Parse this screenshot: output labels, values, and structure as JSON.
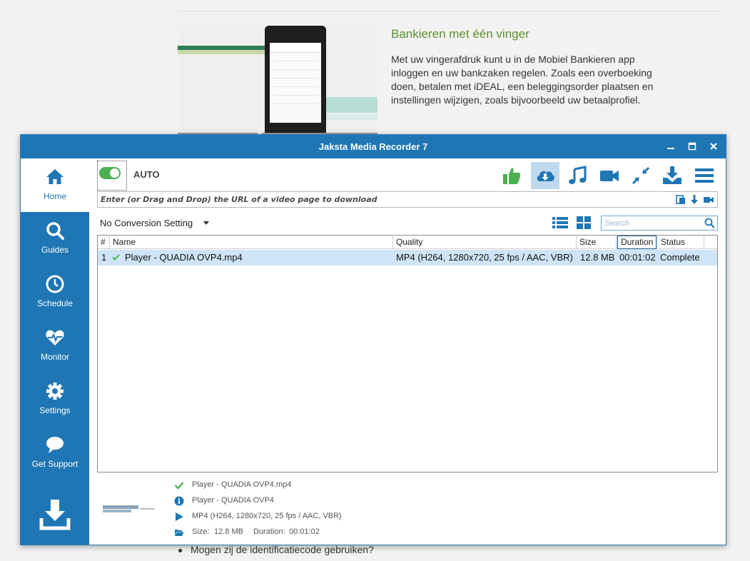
{
  "background_page": {
    "heading": "Bankieren met één vinger",
    "paragraph": "Met uw vingerafdruk kunt u in de Mobiel Bankieren app inloggen en uw bankzaken regelen. Zoals een overboeking doen, betalen met iDEAL, een beleggingsorder plaatsen en instellingen wijzigen, zoals bijvoorbeeld uw betaalprofiel.",
    "bullet": "Mogen zij de identificatiecode gebruiken?"
  },
  "window": {
    "title": "Jaksta Media Recorder 7",
    "controls": [
      "minimize-icon",
      "maximize-icon",
      "close-icon"
    ]
  },
  "sidebar": {
    "items": [
      {
        "label": "Home",
        "icon": "home-icon",
        "active": true
      },
      {
        "label": "Guides",
        "icon": "search-icon"
      },
      {
        "label": "Schedule",
        "icon": "clock-icon"
      },
      {
        "label": "Monitor",
        "icon": "heartbeat-icon"
      },
      {
        "label": "Settings",
        "icon": "gear-icon"
      },
      {
        "label": "Get Support",
        "icon": "speech-bubble-icon"
      }
    ],
    "bottom_icon": "download-icon"
  },
  "toolbar": {
    "auto_label": "AUTO",
    "auto_enabled": true,
    "buttons": [
      "thumbs-up-icon",
      "cloud-download-icon",
      "music-icon",
      "video-camera-icon",
      "compress-icon",
      "tray-download-icon",
      "hamburger-menu-icon"
    ],
    "selected_button": "cloud-download-icon"
  },
  "url_bar": {
    "placeholder": "Enter (or Drag and Drop) the URL of a video page to download",
    "value": "",
    "icons": [
      "paste-icon",
      "arrow-down-icon",
      "video-icon"
    ]
  },
  "conversion": {
    "selected": "No Conversion Setting"
  },
  "search": {
    "placeholder": "Search",
    "value": ""
  },
  "table": {
    "columns": [
      "#",
      "Name",
      "Quality",
      "Size",
      "Duration",
      "Status"
    ],
    "rows": [
      {
        "num": "1",
        "name": "Player - QUADIA OVP4.mp4",
        "quality": "MP4 (H264, 1280x720, 25 fps / AAC, VBR)",
        "size": "12.8 MB",
        "duration": "00:01:02",
        "status": "Complete",
        "selected": true
      }
    ]
  },
  "details": {
    "filename": "Player - QUADIA OVP4.mp4",
    "title": "Player - QUADIA OVP4",
    "format": "MP4 (H264, 1280x720, 25 fps / AAC, VBR)",
    "size_label": "Size:",
    "size": "12.8 MB",
    "duration_label": "Duration:",
    "duration": "00:01:02"
  },
  "colors": {
    "brand_blue": "#1f76b4",
    "selection": "#cfe5f7",
    "toggle_green": "#4caf50",
    "thumb_green": "#4caf50",
    "page_heading_green": "#5a8f2e"
  }
}
